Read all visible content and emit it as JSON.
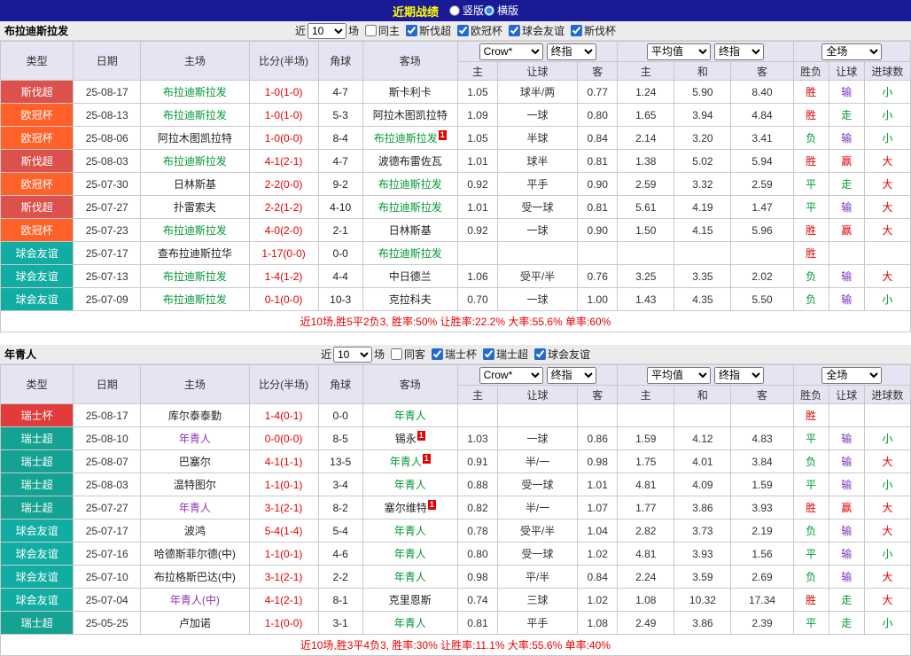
{
  "topbar": {
    "title": "近期战绩",
    "layout_options": [
      {
        "label": "竖版",
        "selected": false
      },
      {
        "label": "横版",
        "selected": true
      }
    ]
  },
  "table_header": {
    "static_cols": [
      "类型",
      "日期",
      "主场",
      "比分(半场)",
      "角球",
      "客场"
    ],
    "sub_cols_odds1": [
      "主",
      "让球",
      "客"
    ],
    "sub_cols_odds2": [
      "主",
      "和",
      "客"
    ],
    "sub_cols_result": [
      "胜负",
      "让球",
      "进球数"
    ]
  },
  "league_colors": {
    "斯伐超": "#dd514c",
    "欧冠杯": "#ff6129",
    "球会友谊": "#12ada2",
    "瑞士杯": "#e13b3b",
    "瑞士超": "#14a292"
  },
  "misc": {
    "red_card_label": "1"
  },
  "sections": [
    {
      "team": "布拉迪斯拉发",
      "filter": {
        "near": "近",
        "count": "10",
        "unit": "场",
        "checkboxes": [
          {
            "label": "同主",
            "checked": false
          },
          {
            "label": "斯伐超",
            "checked": true
          },
          {
            "label": "欧冠杯",
            "checked": true
          },
          {
            "label": "球会友谊",
            "checked": true
          },
          {
            "label": "斯伐杯",
            "checked": true
          }
        ]
      },
      "selects": {
        "bookmaker": "Crow*",
        "odds1_mode": "终指",
        "avg": "平均值",
        "odds2_mode": "终指",
        "scope": "全场"
      },
      "rows": [
        {
          "league": "斯伐超",
          "date": "25-08-17",
          "home": {
            "name": "布拉迪斯拉发",
            "style": "green"
          },
          "score": "1-0(1-0)",
          "corner": "4-7",
          "away": {
            "name": "斯卡利卡",
            "style": "plain"
          },
          "odds": [
            "1.05",
            "球半/两",
            "0.77",
            "1.24",
            "5.90",
            "8.40"
          ],
          "res": [
            {
              "t": "胜",
              "c": "red"
            },
            {
              "t": "输",
              "c": "purple"
            },
            {
              "t": "小",
              "c": "green"
            }
          ]
        },
        {
          "league": "欧冠杯",
          "date": "25-08-13",
          "home": {
            "name": "布拉迪斯拉发",
            "style": "green"
          },
          "score": "1-0(1-0)",
          "corner": "5-3",
          "away": {
            "name": "阿拉木图凯拉特",
            "style": "plain"
          },
          "odds": [
            "1.09",
            "一球",
            "0.80",
            "1.65",
            "3.94",
            "4.84"
          ],
          "res": [
            {
              "t": "胜",
              "c": "red"
            },
            {
              "t": "走",
              "c": "green"
            },
            {
              "t": "小",
              "c": "green"
            }
          ]
        },
        {
          "league": "欧冠杯",
          "date": "25-08-06",
          "home": {
            "name": "阿拉木图凯拉特",
            "style": "plain"
          },
          "score": "1-0(0-0)",
          "corner": "8-4",
          "away": {
            "name": "布拉迪斯拉发",
            "style": "green",
            "rc": true
          },
          "odds": [
            "1.05",
            "半球",
            "0.84",
            "2.14",
            "3.20",
            "3.41"
          ],
          "res": [
            {
              "t": "负",
              "c": "green"
            },
            {
              "t": "输",
              "c": "purple"
            },
            {
              "t": "小",
              "c": "green"
            }
          ]
        },
        {
          "league": "斯伐超",
          "date": "25-08-03",
          "home": {
            "name": "布拉迪斯拉发",
            "style": "green"
          },
          "score": "4-1(2-1)",
          "corner": "4-7",
          "away": {
            "name": "波德布雷佐瓦",
            "style": "plain"
          },
          "odds": [
            "1.01",
            "球半",
            "0.81",
            "1.38",
            "5.02",
            "5.94"
          ],
          "res": [
            {
              "t": "胜",
              "c": "red"
            },
            {
              "t": "赢",
              "c": "red"
            },
            {
              "t": "大",
              "c": "red"
            }
          ]
        },
        {
          "league": "欧冠杯",
          "date": "25-07-30",
          "home": {
            "name": "日林斯基",
            "style": "plain"
          },
          "score": "2-2(0-0)",
          "corner": "9-2",
          "away": {
            "name": "布拉迪斯拉发",
            "style": "green"
          },
          "odds": [
            "0.92",
            "平手",
            "0.90",
            "2.59",
            "3.32",
            "2.59"
          ],
          "res": [
            {
              "t": "平",
              "c": "green"
            },
            {
              "t": "走",
              "c": "green"
            },
            {
              "t": "大",
              "c": "red"
            }
          ]
        },
        {
          "league": "斯伐超",
          "date": "25-07-27",
          "home": {
            "name": "扑雷索夫",
            "style": "plain"
          },
          "score": "2-2(1-2)",
          "corner": "4-10",
          "away": {
            "name": "布拉迪斯拉发",
            "style": "green"
          },
          "odds": [
            "1.01",
            "受一球",
            "0.81",
            "5.61",
            "4.19",
            "1.47"
          ],
          "res": [
            {
              "t": "平",
              "c": "green"
            },
            {
              "t": "输",
              "c": "purple"
            },
            {
              "t": "大",
              "c": "red"
            }
          ]
        },
        {
          "league": "欧冠杯",
          "date": "25-07-23",
          "home": {
            "name": "布拉迪斯拉发",
            "style": "green"
          },
          "score": "4-0(2-0)",
          "corner": "2-1",
          "away": {
            "name": "日林斯基",
            "style": "plain"
          },
          "odds": [
            "0.92",
            "一球",
            "0.90",
            "1.50",
            "4.15",
            "5.96"
          ],
          "res": [
            {
              "t": "胜",
              "c": "red"
            },
            {
              "t": "赢",
              "c": "red"
            },
            {
              "t": "大",
              "c": "red"
            }
          ]
        },
        {
          "league": "球会友谊",
          "date": "25-07-17",
          "home": {
            "name": "查布拉迪斯拉华",
            "style": "plain"
          },
          "score": "1-17(0-0)",
          "corner": "0-0",
          "away": {
            "name": "布拉迪斯拉发",
            "style": "green"
          },
          "odds": [
            "",
            "",
            "",
            "",
            "",
            ""
          ],
          "res": [
            {
              "t": "胜",
              "c": "red"
            },
            {
              "t": "",
              "c": ""
            },
            {
              "t": "",
              "c": ""
            }
          ]
        },
        {
          "league": "球会友谊",
          "date": "25-07-13",
          "home": {
            "name": "布拉迪斯拉发",
            "style": "green"
          },
          "score": "1-4(1-2)",
          "corner": "4-4",
          "away": {
            "name": "中日德兰",
            "style": "plain"
          },
          "odds": [
            "1.06",
            "受平/半",
            "0.76",
            "3.25",
            "3.35",
            "2.02"
          ],
          "res": [
            {
              "t": "负",
              "c": "green"
            },
            {
              "t": "输",
              "c": "purple"
            },
            {
              "t": "大",
              "c": "red"
            }
          ]
        },
        {
          "league": "球会友谊",
          "date": "25-07-09",
          "home": {
            "name": "布拉迪斯拉发",
            "style": "green"
          },
          "score": "0-1(0-0)",
          "corner": "10-3",
          "away": {
            "name": "克拉科夫",
            "style": "plain"
          },
          "odds": [
            "0.70",
            "一球",
            "1.00",
            "1.43",
            "4.35",
            "5.50"
          ],
          "res": [
            {
              "t": "负",
              "c": "green"
            },
            {
              "t": "输",
              "c": "purple"
            },
            {
              "t": "小",
              "c": "green"
            }
          ]
        }
      ],
      "summary": "近10场,胜5平2负3, 胜率:50% 让胜率:22.2% 大率:55.6% 单率:60%"
    },
    {
      "team": "年青人",
      "filter": {
        "near": "近",
        "count": "10",
        "unit": "场",
        "checkboxes": [
          {
            "label": "同客",
            "checked": false
          },
          {
            "label": "瑞士杯",
            "checked": true
          },
          {
            "label": "瑞士超",
            "checked": true
          },
          {
            "label": "球会友谊",
            "checked": true
          }
        ]
      },
      "selects": {
        "bookmaker": "Crow*",
        "odds1_mode": "终指",
        "avg": "平均值",
        "odds2_mode": "终指",
        "scope": "全场"
      },
      "rows": [
        {
          "league": "瑞士杯",
          "date": "25-08-17",
          "home": {
            "name": "库尔泰泰勤",
            "style": "plain"
          },
          "score": "1-4(0-1)",
          "corner": "0-0",
          "away": {
            "name": "年青人",
            "style": "green"
          },
          "odds": [
            "",
            "",
            "",
            "",
            "",
            ""
          ],
          "res": [
            {
              "t": "胜",
              "c": "red"
            },
            {
              "t": "",
              "c": ""
            },
            {
              "t": "",
              "c": ""
            }
          ]
        },
        {
          "league": "瑞士超",
          "date": "25-08-10",
          "home": {
            "name": "年青人",
            "style": "purple"
          },
          "score": "0-0(0-0)",
          "corner": "8-5",
          "away": {
            "name": "锡永",
            "style": "plain",
            "rc": true
          },
          "odds": [
            "1.03",
            "一球",
            "0.86",
            "1.59",
            "4.12",
            "4.83"
          ],
          "res": [
            {
              "t": "平",
              "c": "green"
            },
            {
              "t": "输",
              "c": "purple"
            },
            {
              "t": "小",
              "c": "green"
            }
          ]
        },
        {
          "league": "瑞士超",
          "date": "25-08-07",
          "home": {
            "name": "巴塞尔",
            "style": "plain"
          },
          "score": "4-1(1-1)",
          "corner": "13-5",
          "away": {
            "name": "年青人",
            "style": "green",
            "rc": true
          },
          "odds": [
            "0.91",
            "半/一",
            "0.98",
            "1.75",
            "4.01",
            "3.84"
          ],
          "res": [
            {
              "t": "负",
              "c": "green"
            },
            {
              "t": "输",
              "c": "purple"
            },
            {
              "t": "大",
              "c": "red"
            }
          ]
        },
        {
          "league": "瑞士超",
          "date": "25-08-03",
          "home": {
            "name": "温特图尔",
            "style": "plain"
          },
          "score": "1-1(0-1)",
          "corner": "3-4",
          "away": {
            "name": "年青人",
            "style": "green"
          },
          "odds": [
            "0.88",
            "受一球",
            "1.01",
            "4.81",
            "4.09",
            "1.59"
          ],
          "res": [
            {
              "t": "平",
              "c": "green"
            },
            {
              "t": "输",
              "c": "purple"
            },
            {
              "t": "小",
              "c": "green"
            }
          ]
        },
        {
          "league": "瑞士超",
          "date": "25-07-27",
          "home": {
            "name": "年青人",
            "style": "purple"
          },
          "score": "3-1(2-1)",
          "corner": "8-2",
          "away": {
            "name": "塞尔维特",
            "style": "plain",
            "rc": true
          },
          "odds": [
            "0.82",
            "半/一",
            "1.07",
            "1.77",
            "3.86",
            "3.93"
          ],
          "res": [
            {
              "t": "胜",
              "c": "red"
            },
            {
              "t": "赢",
              "c": "red"
            },
            {
              "t": "大",
              "c": "red"
            }
          ]
        },
        {
          "league": "球会友谊",
          "date": "25-07-17",
          "home": {
            "name": "波鸿",
            "style": "plain"
          },
          "score": "5-4(1-4)",
          "corner": "5-4",
          "away": {
            "name": "年青人",
            "style": "green"
          },
          "odds": [
            "0.78",
            "受平/半",
            "1.04",
            "2.82",
            "3.73",
            "2.19"
          ],
          "res": [
            {
              "t": "负",
              "c": "green"
            },
            {
              "t": "输",
              "c": "purple"
            },
            {
              "t": "大",
              "c": "red"
            }
          ]
        },
        {
          "league": "球会友谊",
          "date": "25-07-16",
          "home": {
            "name": "哈德斯菲尔德(中)",
            "style": "plain"
          },
          "score": "1-1(0-1)",
          "corner": "4-6",
          "away": {
            "name": "年青人",
            "style": "green"
          },
          "odds": [
            "0.80",
            "受一球",
            "1.02",
            "4.81",
            "3.93",
            "1.56"
          ],
          "res": [
            {
              "t": "平",
              "c": "green"
            },
            {
              "t": "输",
              "c": "purple"
            },
            {
              "t": "小",
              "c": "green"
            }
          ]
        },
        {
          "league": "球会友谊",
          "date": "25-07-10",
          "home": {
            "name": "布拉格斯巴达(中)",
            "style": "plain"
          },
          "score": "3-1(2-1)",
          "corner": "2-2",
          "away": {
            "name": "年青人",
            "style": "green"
          },
          "odds": [
            "0.98",
            "平/半",
            "0.84",
            "2.24",
            "3.59",
            "2.69"
          ],
          "res": [
            {
              "t": "负",
              "c": "green"
            },
            {
              "t": "输",
              "c": "purple"
            },
            {
              "t": "大",
              "c": "red"
            }
          ]
        },
        {
          "league": "球会友谊",
          "date": "25-07-04",
          "home": {
            "name": "年青人(中)",
            "style": "purple"
          },
          "score": "4-1(2-1)",
          "corner": "8-1",
          "away": {
            "name": "克里恩斯",
            "style": "plain"
          },
          "odds": [
            "0.74",
            "三球",
            "1.02",
            "1.08",
            "10.32",
            "17.34"
          ],
          "res": [
            {
              "t": "胜",
              "c": "red"
            },
            {
              "t": "走",
              "c": "green"
            },
            {
              "t": "大",
              "c": "red"
            }
          ]
        },
        {
          "league": "瑞士超",
          "date": "25-05-25",
          "home": {
            "name": "卢加诺",
            "style": "plain"
          },
          "score": "1-1(0-0)",
          "corner": "3-1",
          "away": {
            "name": "年青人",
            "style": "green"
          },
          "odds": [
            "0.81",
            "平手",
            "1.08",
            "2.49",
            "3.86",
            "2.39"
          ],
          "res": [
            {
              "t": "平",
              "c": "green"
            },
            {
              "t": "走",
              "c": "green"
            },
            {
              "t": "小",
              "c": "green"
            }
          ]
        }
      ],
      "summary": "近10场,胜3平4负3, 胜率:30% 让胜率:11.1% 大率:55.6% 单率:40%"
    }
  ]
}
